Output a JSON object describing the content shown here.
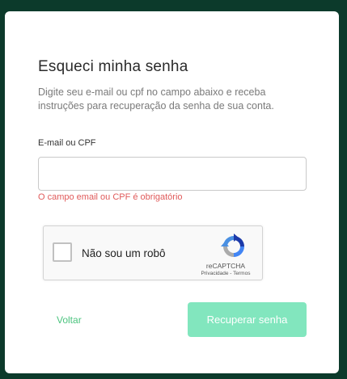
{
  "page": {
    "title": "Esqueci minha senha",
    "description": "Digite seu e-mail ou cpf no campo abaixo e receba instruções para recuperação da senha de sua conta."
  },
  "form": {
    "field_label": "E-mail ou CPF",
    "field_value": "",
    "field_placeholder": "",
    "error_message": "O campo email ou CPF é obrigatório"
  },
  "recaptcha": {
    "label": "Não sou um robô",
    "brand": "reCAPTCHA",
    "links": "Privacidade - Termos",
    "icon": "recaptcha-logo-icon"
  },
  "actions": {
    "back_label": "Voltar",
    "submit_label": "Recuperar senha"
  },
  "colors": {
    "background": "#0c3a2b",
    "accent": "#4cc47f",
    "button": "#82e6be",
    "error": "#e05a5a"
  }
}
